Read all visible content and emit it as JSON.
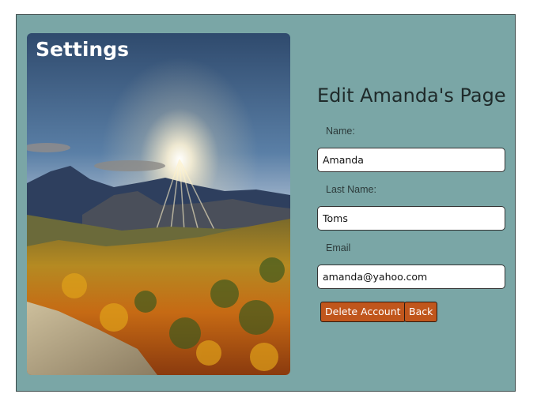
{
  "settings": {
    "title": "Settings",
    "image": "mountain-forest-sunrise-photo"
  },
  "form": {
    "title": "Edit Amanda's Page",
    "name_label": "Name:",
    "name_value": "Amanda",
    "lastname_label": "Last Name:",
    "lastname_value": "Toms",
    "email_label": "Email",
    "email_value": "amanda@yahoo.com"
  },
  "buttons": {
    "delete_label": "Delete Account",
    "back_label": "Back"
  },
  "colors": {
    "panel_background": "#7aa6a6",
    "button_background": "#c0561c"
  }
}
